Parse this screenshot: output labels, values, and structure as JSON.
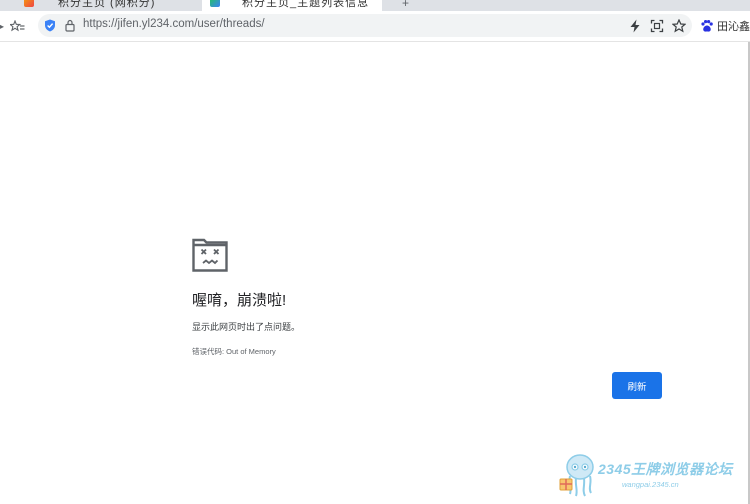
{
  "tabs": [
    {
      "title": "积分主页 (网积分)"
    },
    {
      "title": "积分主页_主题列表信息"
    }
  ],
  "toolbar": {
    "url": "https://jifen.yl234.com/user/threads/",
    "profile_name": "田沁鑫"
  },
  "crash": {
    "title": "喔唷，崩溃啦!",
    "message": "显示此网页时出了点问题。",
    "error_code": "错误代码:  Out of Memory",
    "reload_label": "刷新"
  },
  "watermark": {
    "brand": "2345王牌浏览器论坛",
    "url": "wangpai.2345.cn"
  },
  "colors": {
    "accent": "#1a73e8",
    "omnibox_bg": "#f1f3f4",
    "tabstrip_bg": "#dee1e6"
  }
}
